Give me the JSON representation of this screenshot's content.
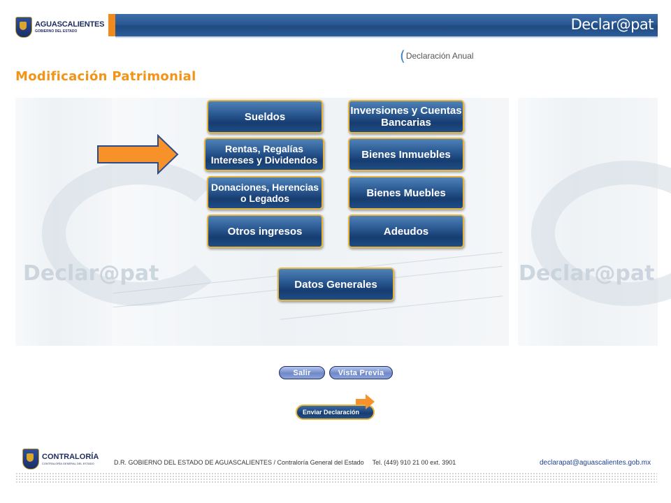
{
  "header": {
    "logo_title": "AGUASCALIENTES",
    "logo_subtitle": "GOBIERNO DEL ESTADO",
    "brand": "Declar@pat"
  },
  "subtitle": "Declaración Anual",
  "page_title": "Modificación Patrimonial",
  "watermark": "Declar@pat",
  "menu": {
    "sueldos": "Sueldos",
    "inversiones": "Inversiones y Cuentas Bancarias",
    "rentas": "Rentas, Regalías Intereses y Dividendos",
    "bienes_inmuebles": "Bienes Inmuebles",
    "donaciones": "Donaciones, Herencias o Legados",
    "bienes_muebles": "Bienes Muebles",
    "otros_ingresos": "Otros ingresos",
    "adeudos": "Adeudos",
    "datos_generales": "Datos Generales"
  },
  "actions": {
    "salir": "Salir",
    "vista_previa": "Vista Previa",
    "enviar": "Enviar Declaración"
  },
  "footer": {
    "logo_title": "CONTRALORÍA",
    "logo_subtitle": "CONTRALORÍA GENERAL DEL ESTADO",
    "copyright": "D.R. GOBIERNO DEL ESTADO DE AGUASCALIENTES / Contraloría General del Estado",
    "phone": "Tel. (449) 910 21 00 ext. 3901",
    "email": "declarapat@aguascalientes.gob.mx"
  },
  "colors": {
    "accent_orange": "#f39317",
    "header_blue": "#2a5893",
    "button_border": "#e8b43a"
  }
}
